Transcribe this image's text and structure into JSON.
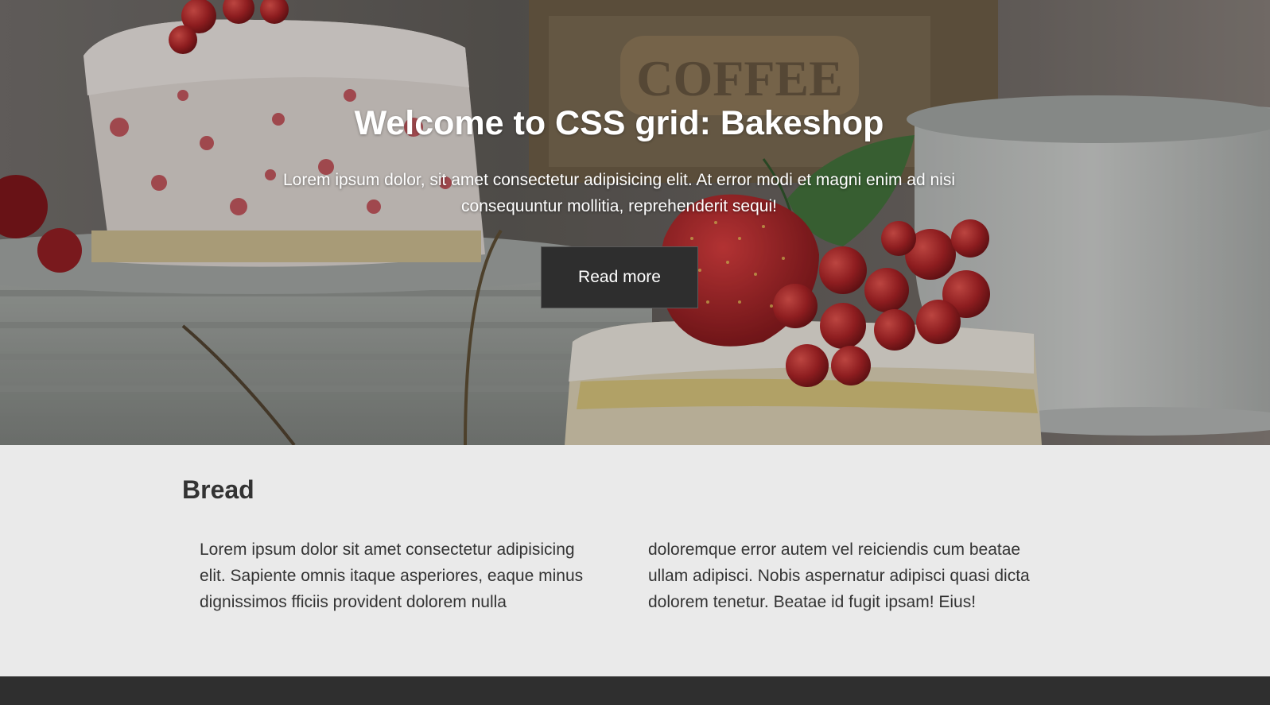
{
  "hero": {
    "title": "Welcome to CSS grid: Bakeshop",
    "text": "Lorem ipsum dolor, sit amet consectetur adipisicing elit. At error modi et magni enim ad nisi consequuntur mollitia, reprehenderit sequi!",
    "button_label": "Read more",
    "background_image": "cake-with-strawberry-and-currants-photo"
  },
  "bread": {
    "title": "Bread",
    "text": "Lorem ipsum dolor sit amet consectetur adipisicing elit. Sapiente omnis itaque asperiores, eaque minus dignissimos fficiis provident dolorem nulla doloremque error autem vel reiciendis cum beatae ullam adipisci. Nobis aspernatur adipisci quasi dicta dolorem tenetur. Beatae id fugit ipsam! Eius!"
  },
  "colors": {
    "button_bg": "#2e2e2e",
    "section_bg": "#eaeaea",
    "footer_bg": "#2f2f2f",
    "text_dark": "#333333"
  }
}
